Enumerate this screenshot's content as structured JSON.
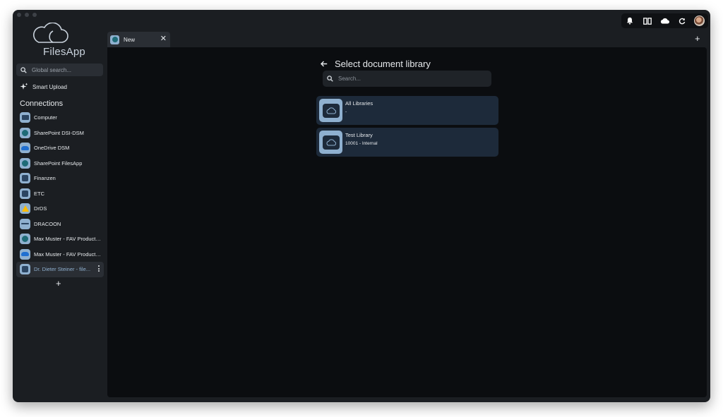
{
  "app": {
    "name": "FilesApp"
  },
  "sidebar": {
    "search_placeholder": "Global search...",
    "smart_upload_label": "Smart Upload",
    "connections_heading": "Connections",
    "connections": [
      {
        "label": "Computer",
        "icon": "computer-icon"
      },
      {
        "label": "SharePoint DSI-DSM",
        "icon": "sharepoint-icon"
      },
      {
        "label": "OneDrive DSM",
        "icon": "onedrive-icon"
      },
      {
        "label": "SharePoint FilesApp",
        "icon": "sharepoint-icon"
      },
      {
        "label": "Finanzen",
        "icon": "storage-icon"
      },
      {
        "label": "ETC",
        "icon": "storage-icon"
      },
      {
        "label": "DrDS",
        "icon": "google-drive-icon"
      },
      {
        "label": "DRACOON",
        "icon": "dracoon-icon"
      },
      {
        "label": "Max Muster - FAV Production",
        "icon": "sharepoint-icon"
      },
      {
        "label": "Max Muster - FAV Production",
        "icon": "onedrive-icon"
      },
      {
        "label": "Dr. Dieter Steiner - file...",
        "icon": "storage-icon",
        "active": true
      }
    ],
    "add_connection_label": "+"
  },
  "tabs": [
    {
      "label": "New",
      "close": "✕"
    }
  ],
  "new_tab_label": "+",
  "header_icons": [
    "bell-icon",
    "split-view-icon",
    "cloud-icon",
    "refresh-icon",
    "avatar"
  ],
  "panel": {
    "title": "Select document library",
    "search_placeholder": "Search...",
    "libraries": [
      {
        "name": "All Libraries",
        "subtitle": "-"
      },
      {
        "name": "Test Library",
        "subtitle": "10001 - Internal"
      }
    ]
  },
  "colors": {
    "accent": "#8fb0cf",
    "card": "#1d2a3a",
    "background": "#0b0d10"
  }
}
